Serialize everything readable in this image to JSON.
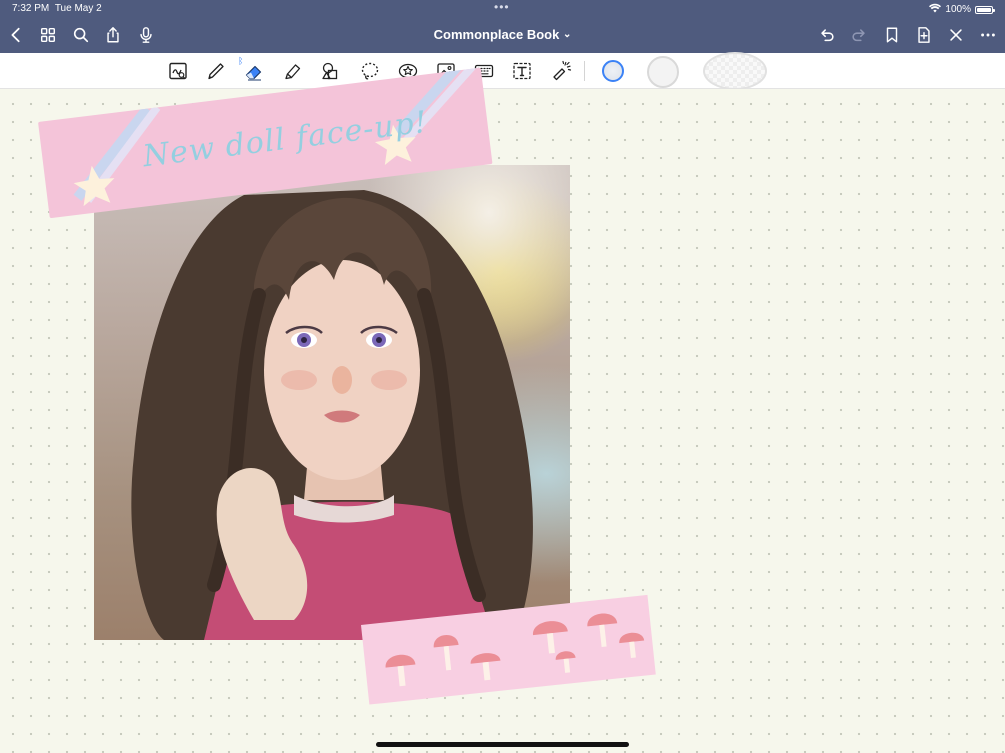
{
  "status_bar": {
    "time": "7:32 PM",
    "date": "Tue May 2",
    "battery_text": "100%",
    "battery_level": 1.0,
    "wifi_icon": "wifi-icon",
    "multitask_dots": "•••"
  },
  "nav": {
    "title": "Commonplace Book",
    "title_chevron": "⌄",
    "left_icons": [
      "back-icon",
      "grid-icon",
      "search-icon",
      "share-icon",
      "microphone-icon"
    ],
    "right_icons": [
      "undo-icon",
      "redo-icon",
      "bookmark-icon",
      "add-page-icon",
      "close-icon",
      "more-icon"
    ]
  },
  "toolbar": {
    "tools": [
      "read-only-icon",
      "pen-icon",
      "eraser-icon",
      "highlighter-icon",
      "shapes-icon",
      "lasso-icon",
      "elements-icon",
      "image-icon",
      "keyboard-icon",
      "text-box-icon",
      "laser-pointer-icon"
    ],
    "selected_tool": "eraser-icon",
    "bluetooth_indicator": "bluetooth-icon",
    "eraser_sizes": [
      "small",
      "medium",
      "large"
    ],
    "selected_eraser_size": "small"
  },
  "canvas": {
    "banner_sticker_text": "New doll face-up!",
    "photo_description_alt": "doll photo"
  },
  "colors": {
    "nav_background": "#4f5b7e",
    "accent_blue": "#3b82f6",
    "paper": "#f6f7ec",
    "sticker_pink": "#f4c4d9",
    "banner_text": "#94cfe0"
  }
}
